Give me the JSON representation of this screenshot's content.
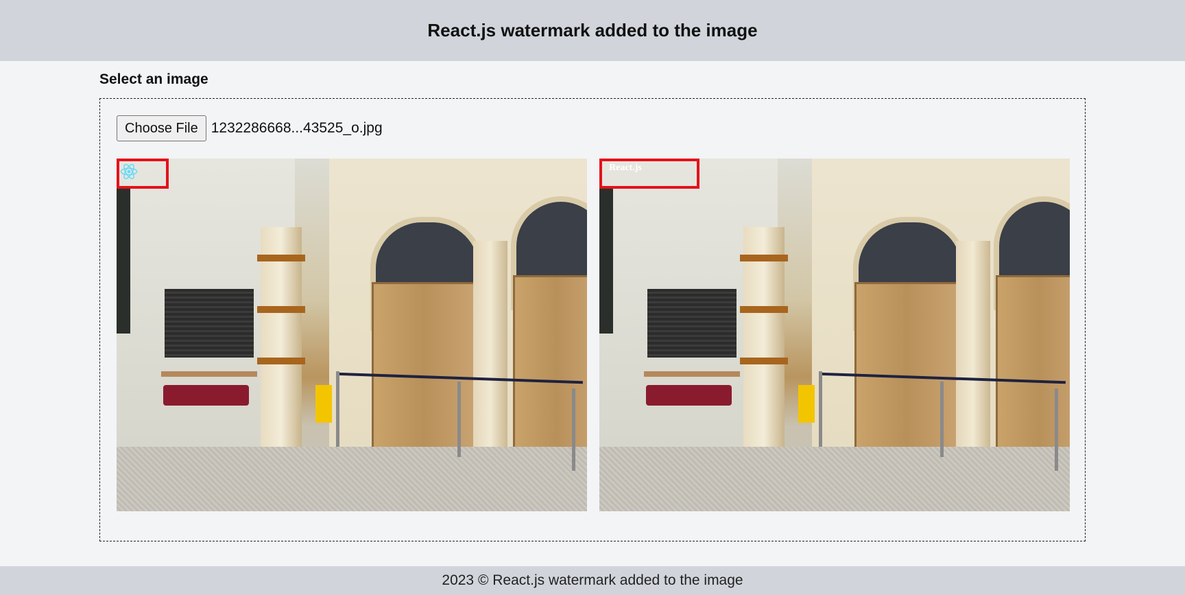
{
  "header": {
    "title": "React.js watermark added to the image"
  },
  "main": {
    "select_label": "Select an image",
    "file_input": {
      "button_label": "Choose File",
      "file_name": "1232286668...43525_o.jpg"
    },
    "images": [
      {
        "watermark_type": "logo",
        "watermark_icon": "react-logo-icon"
      },
      {
        "watermark_type": "text",
        "watermark_text": "React.js"
      }
    ]
  },
  "footer": {
    "text": "2023 © React.js watermark added to the image"
  },
  "colors": {
    "header_bg": "#d1d5db",
    "page_bg": "#f3f4f6",
    "highlight": "#e4121b",
    "react_cyan": "#61dafb"
  }
}
